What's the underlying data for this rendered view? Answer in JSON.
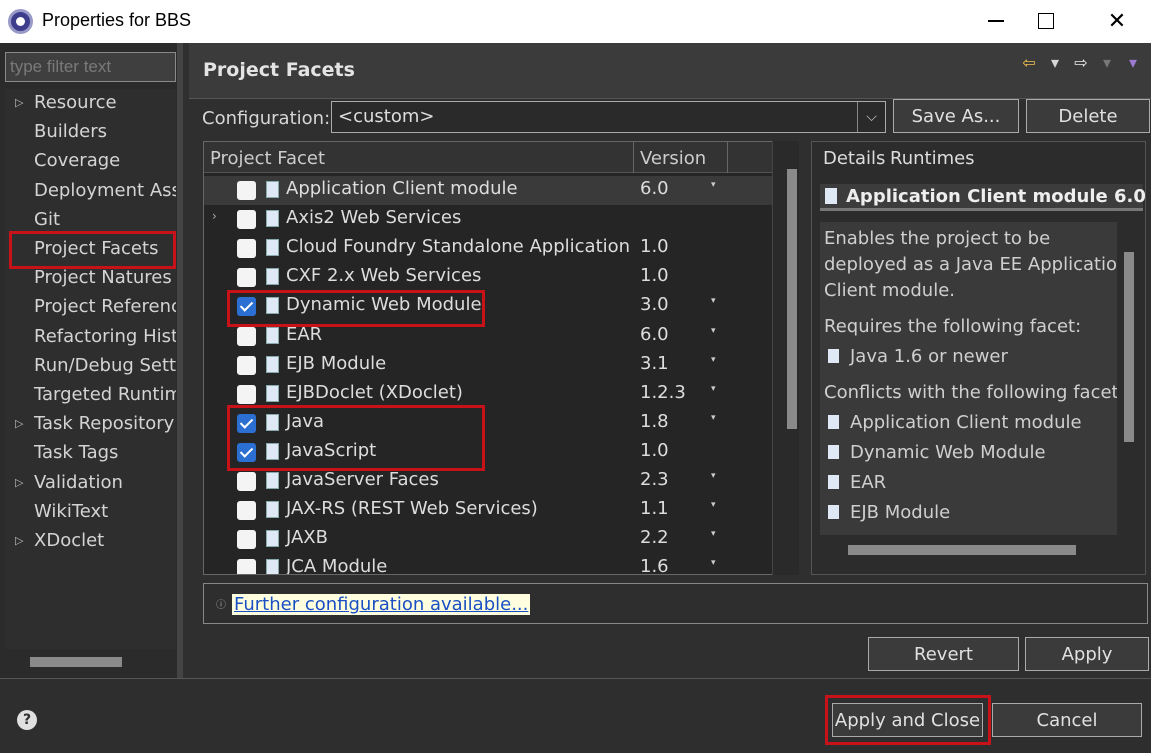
{
  "window": {
    "title": "Properties for BBS",
    "close_glyph": "✕"
  },
  "sidebar": {
    "filter_placeholder": "type filter text",
    "items": [
      {
        "label": "Resource",
        "arrow": "▷"
      },
      {
        "label": "Builders",
        "arrow": ""
      },
      {
        "label": "Coverage",
        "arrow": ""
      },
      {
        "label": "Deployment Asse",
        "arrow": ""
      },
      {
        "label": "Git",
        "arrow": ""
      },
      {
        "label": "Project Facets",
        "arrow": ""
      },
      {
        "label": "Project Natures",
        "arrow": ""
      },
      {
        "label": "Project Reference",
        "arrow": ""
      },
      {
        "label": "Refactoring Histo",
        "arrow": ""
      },
      {
        "label": "Run/Debug Setti",
        "arrow": ""
      },
      {
        "label": "Targeted Runtim",
        "arrow": ""
      },
      {
        "label": "Task Repository",
        "arrow": "▷"
      },
      {
        "label": "Task Tags",
        "arrow": ""
      },
      {
        "label": "Validation",
        "arrow": "▷"
      },
      {
        "label": "WikiText",
        "arrow": ""
      },
      {
        "label": "XDoclet",
        "arrow": "▷"
      }
    ]
  },
  "page": {
    "title": "Project Facets",
    "nav": {
      "back": "⇦",
      "forward": "⇨",
      "menu": "▾"
    }
  },
  "configuration": {
    "label": "Configuration:",
    "value": "<custom>",
    "save_as": "Save As...",
    "delete": "Delete"
  },
  "facets": {
    "col_facet": "Project Facet",
    "col_version": "Version",
    "rows": [
      {
        "name": "Application Client module",
        "version": "6.0",
        "checked": false,
        "expander": "",
        "dropdown": "▾"
      },
      {
        "name": "Axis2 Web Services",
        "version": "",
        "checked": false,
        "expander": "›",
        "dropdown": ""
      },
      {
        "name": "Cloud Foundry Standalone Application",
        "version": "1.0",
        "checked": false,
        "expander": "",
        "dropdown": ""
      },
      {
        "name": "CXF 2.x Web Services",
        "version": "1.0",
        "checked": false,
        "expander": "",
        "dropdown": ""
      },
      {
        "name": "Dynamic Web Module",
        "version": "3.0",
        "checked": true,
        "expander": "",
        "dropdown": "▾"
      },
      {
        "name": "EAR",
        "version": "6.0",
        "checked": false,
        "expander": "",
        "dropdown": "▾"
      },
      {
        "name": "EJB Module",
        "version": "3.1",
        "checked": false,
        "expander": "",
        "dropdown": "▾"
      },
      {
        "name": "EJBDoclet (XDoclet)",
        "version": "1.2.3",
        "checked": false,
        "expander": "",
        "dropdown": "▾"
      },
      {
        "name": "Java",
        "version": "1.8",
        "checked": true,
        "expander": "",
        "dropdown": "▾"
      },
      {
        "name": "JavaScript",
        "version": "1.0",
        "checked": true,
        "expander": "",
        "dropdown": ""
      },
      {
        "name": "JavaServer Faces",
        "version": "2.3",
        "checked": false,
        "expander": "",
        "dropdown": "▾"
      },
      {
        "name": "JAX-RS (REST Web Services)",
        "version": "1.1",
        "checked": false,
        "expander": "",
        "dropdown": "▾"
      },
      {
        "name": "JAXB",
        "version": "2.2",
        "checked": false,
        "expander": "",
        "dropdown": "▾"
      },
      {
        "name": "JCA Module",
        "version": "1.6",
        "checked": false,
        "expander": "",
        "dropdown": "▾"
      }
    ]
  },
  "details": {
    "tab_details": "Details",
    "tab_runtimes": "Runtimes",
    "title": "Application Client module 6.0",
    "description": [
      "Enables the project to be",
      "deployed as a Java EE Application",
      "Client module."
    ],
    "requires_label": "Requires the following facet:",
    "requires": [
      "Java 1.6 or newer"
    ],
    "conflicts_label": "Conflicts with the following facets:",
    "conflicts": [
      "Application Client module",
      "Dynamic Web Module",
      "EAR",
      "EJB Module"
    ]
  },
  "further_config": {
    "link": "Further configuration available..."
  },
  "actions": {
    "revert": "Revert",
    "apply": "Apply",
    "apply_and_close": "Apply and Close",
    "cancel": "Cancel",
    "help": "?"
  }
}
